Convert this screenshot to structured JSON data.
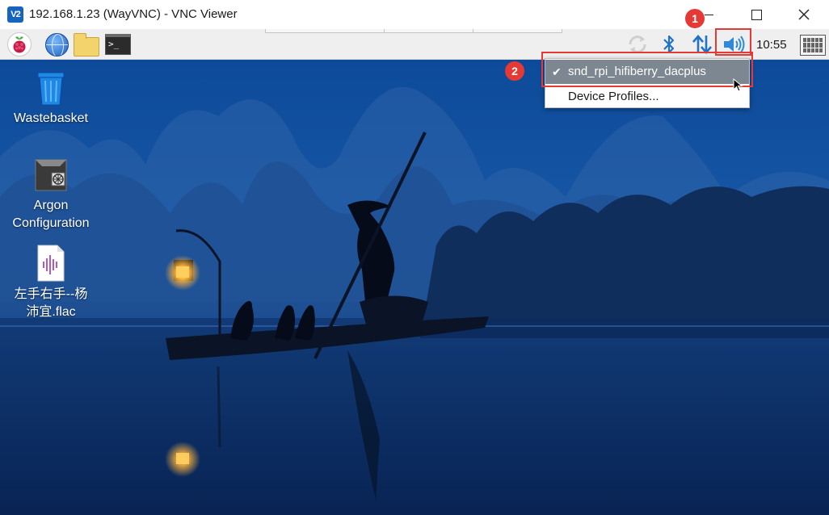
{
  "window": {
    "app_icon": "V2",
    "title": "192.168.1.23 (WayVNC) - VNC Viewer"
  },
  "panel": {
    "terminal_glyph": ">_",
    "clock": "10:55",
    "icons": [
      "raspberry-menu-icon",
      "web-browser-icon",
      "file-manager-icon",
      "terminal-icon",
      "sync-icon",
      "bluetooth-icon",
      "network-icon",
      "volume-icon",
      "keyboard-icon"
    ]
  },
  "desktop": {
    "items": [
      {
        "label": "Wastebasket",
        "icon": "wastebasket-icon"
      },
      {
        "label": "Argon\nConfiguration",
        "icon": "argon-config-icon"
      },
      {
        "label": "左手右手--杨\n沛宜.flac",
        "icon": "audio-file-icon"
      }
    ]
  },
  "audio_menu": {
    "items": [
      {
        "label": "snd_rpi_hifiberry_dacplus",
        "checked": true
      },
      {
        "label": "Device Profiles...",
        "checked": false
      }
    ],
    "check_glyph": "✔"
  },
  "annotations": {
    "badge_1": "1",
    "badge_2": "2",
    "color": "#e53935"
  },
  "colors": {
    "menu_highlight": "#7d8791",
    "volume_icon": "#2e8ad8",
    "desktop_sky": "#0f4f98"
  }
}
